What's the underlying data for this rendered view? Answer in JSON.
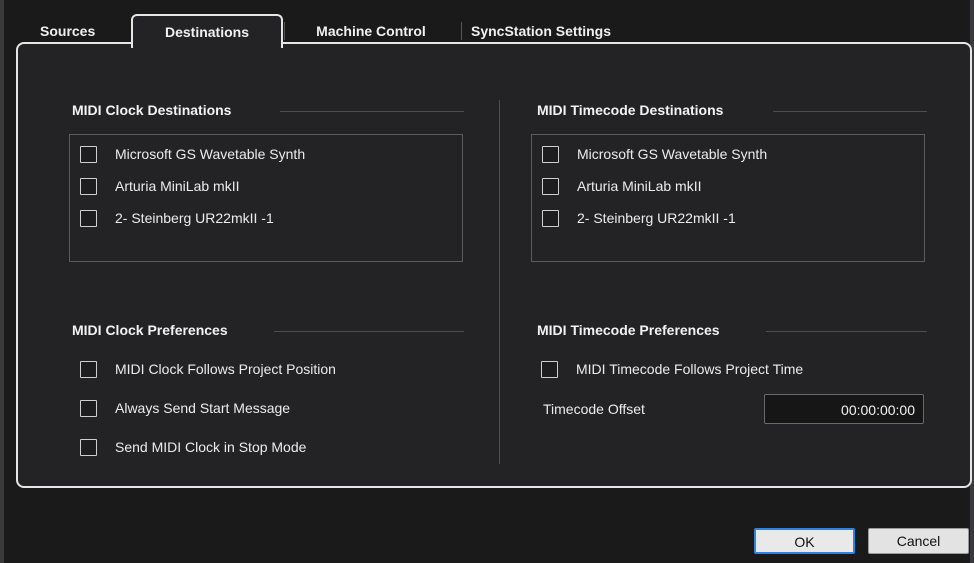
{
  "tabs": [
    "Sources",
    "Destinations",
    "Machine Control",
    "SyncStation Settings"
  ],
  "active_tab": "Destinations",
  "midi_clock_destinations": {
    "title": "MIDI Clock Destinations",
    "items": [
      {
        "label": "Microsoft GS Wavetable Synth",
        "checked": false
      },
      {
        "label": "Arturia MiniLab mkII",
        "checked": false
      },
      {
        "label": "2- Steinberg UR22mkII -1",
        "checked": false
      }
    ]
  },
  "midi_timecode_destinations": {
    "title": "MIDI Timecode Destinations",
    "items": [
      {
        "label": "Microsoft GS Wavetable Synth",
        "checked": false
      },
      {
        "label": "Arturia MiniLab mkII",
        "checked": false
      },
      {
        "label": "2- Steinberg UR22mkII -1",
        "checked": false
      }
    ]
  },
  "midi_clock_preferences": {
    "title": "MIDI Clock Preferences",
    "items": [
      {
        "label": "MIDI Clock Follows Project Position",
        "checked": false
      },
      {
        "label": "Always Send Start Message",
        "checked": false
      },
      {
        "label": "Send MIDI Clock in Stop Mode",
        "checked": false
      }
    ]
  },
  "midi_timecode_preferences": {
    "title": "MIDI Timecode Preferences",
    "items": [
      {
        "label": "MIDI Timecode Follows Project Time",
        "checked": false
      }
    ],
    "offset_label": "Timecode Offset",
    "offset_value": "00:00:00:00"
  },
  "buttons": {
    "ok": "OK",
    "cancel": "Cancel"
  },
  "colors": {
    "accent": "#2f84e0",
    "background": "#232326",
    "border": "#e6e6e6"
  }
}
